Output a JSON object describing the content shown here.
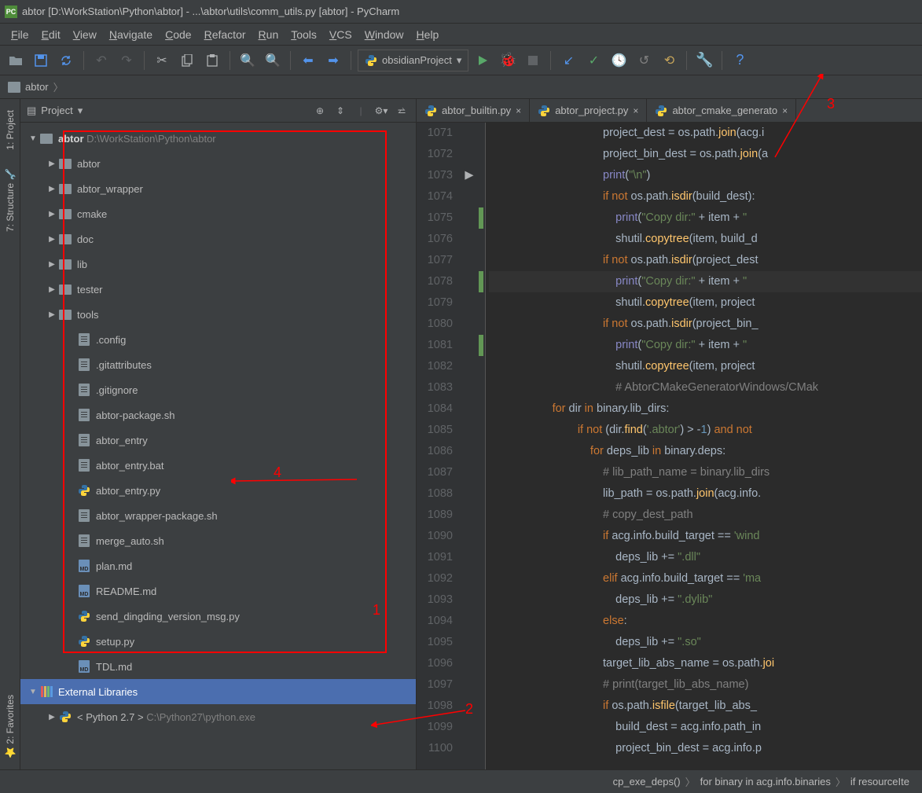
{
  "title": "abtor [D:\\WorkStation\\Python\\abtor] - ...\\abtor\\utils\\comm_utils.py [abtor] - PyCharm",
  "menu": [
    "File",
    "Edit",
    "View",
    "Navigate",
    "Code",
    "Refactor",
    "Run",
    "Tools",
    "VCS",
    "Window",
    "Help"
  ],
  "runconfig": "obsidianProject",
  "breadcrumb_root": "abtor",
  "project_panel": {
    "title": "Project"
  },
  "tree": {
    "root_name": "abtor",
    "root_path": "D:\\WorkStation\\Python\\abtor",
    "folders": [
      "abtor",
      "abtor_wrapper",
      "cmake",
      "doc",
      "lib",
      "tester",
      "tools"
    ],
    "files": [
      {
        "name": ".config",
        "icon": "file"
      },
      {
        "name": ".gitattributes",
        "icon": "file"
      },
      {
        "name": ".gitignore",
        "icon": "file"
      },
      {
        "name": "abtor-package.sh",
        "icon": "file"
      },
      {
        "name": "abtor_entry",
        "icon": "file"
      },
      {
        "name": "abtor_entry.bat",
        "icon": "file"
      },
      {
        "name": "abtor_entry.py",
        "icon": "py"
      },
      {
        "name": "abtor_wrapper-package.sh",
        "icon": "file"
      },
      {
        "name": "merge_auto.sh",
        "icon": "file"
      },
      {
        "name": "plan.md",
        "icon": "md"
      },
      {
        "name": "README.md",
        "icon": "md"
      },
      {
        "name": "send_dingding_version_msg.py",
        "icon": "py"
      },
      {
        "name": "setup.py",
        "icon": "py"
      },
      {
        "name": "TDL.md",
        "icon": "md"
      }
    ],
    "extlib_label": "External Libraries",
    "python_label": "< Python 2.7 >",
    "python_path": "C:\\Python27\\python.exe"
  },
  "tabs": [
    "abtor_builtin.py",
    "abtor_project.py",
    "abtor_cmake_generato"
  ],
  "code_lines": [
    {
      "n": 1071,
      "ind": 20,
      "html": "project_dest = os.path.<span class='fn'>join</span>(acg.i"
    },
    {
      "n": 1072,
      "ind": 20,
      "html": "project_bin_dest = os.path.<span class='fn'>join</span>(a"
    },
    {
      "n": 1073,
      "ind": 20,
      "html": "<span class='builtin'>print</span>(<span class='str'>\"\\n\"</span>)",
      "mk": "play"
    },
    {
      "n": 1074,
      "ind": 20,
      "html": "<span class='kw'>if not </span>os.path.<span class='fn'>isdir</span>(build_dest):"
    },
    {
      "n": 1075,
      "ind": 21,
      "html": "<span class='builtin'>print</span>(<span class='str'>\"Copy dir:\"</span> + item + <span class='str'>\"</span>",
      "mg": true
    },
    {
      "n": 1076,
      "ind": 21,
      "html": "shutil.<span class='fn'>copytree</span>(item, build_d"
    },
    {
      "n": 1077,
      "ind": 20,
      "html": "<span class='kw'>if not </span>os.path.<span class='fn'>isdir</span>(project_dest"
    },
    {
      "n": 1078,
      "ind": 21,
      "html": "<span class='builtin'>print</span>(<span class='str'>\"Copy dir:\"</span> + item + <span class='str'>\"</span>",
      "mg": true,
      "hl": true
    },
    {
      "n": 1079,
      "ind": 21,
      "html": "shutil.<span class='fn'>copytree</span>(item, project"
    },
    {
      "n": 1080,
      "ind": 20,
      "html": "<span class='kw'>if not </span>os.path.<span class='fn'>isdir</span>(project_bin_"
    },
    {
      "n": 1081,
      "ind": 21,
      "html": "<span class='builtin'>print</span>(<span class='str'>\"Copy dir:\"</span> + item + <span class='str'>\"</span>",
      "mg": true
    },
    {
      "n": 1082,
      "ind": 21,
      "html": "shutil.<span class='fn'>copytree</span>(item, project"
    },
    {
      "n": 1083,
      "ind": 21,
      "html": "<span class='cm'># AbtorCMakeGeneratorWindows/CMak</span>"
    },
    {
      "n": 1084,
      "ind": 16,
      "html": "<span class='kw'>for </span>dir<span class='kw'> in </span>binary.lib_dirs:"
    },
    {
      "n": 1085,
      "ind": 18,
      "html": "<span class='kw'>if not </span>(dir.<span class='fn'>find</span>(<span class='str'>'.abtor'</span>) &gt; -<span class='nm'>1</span>)<span class='kw'> and not</span>"
    },
    {
      "n": 1086,
      "ind": 19,
      "html": "<span class='kw'>for </span>deps_lib<span class='kw'> in </span>binary.deps:"
    },
    {
      "n": 1087,
      "ind": 20,
      "html": "<span class='cm'># lib_path_name = binary.lib_dirs</span>"
    },
    {
      "n": 1088,
      "ind": 20,
      "html": "lib_path = os.path.<span class='fn'>join</span>(acg.info."
    },
    {
      "n": 1089,
      "ind": 20,
      "html": "<span class='cm'># copy_dest_path</span>"
    },
    {
      "n": 1090,
      "ind": 20,
      "html": "<span class='kw'>if </span>acg.info.build_target == <span class='str'>'wind</span>"
    },
    {
      "n": 1091,
      "ind": 21,
      "html": "deps_lib += <span class='str'>\".dll\"</span>"
    },
    {
      "n": 1092,
      "ind": 20,
      "html": "<span class='kw'>elif </span>acg.info.build_target == <span class='str'>'ma</span>"
    },
    {
      "n": 1093,
      "ind": 21,
      "html": "deps_lib += <span class='str'>\".dylib\"</span>"
    },
    {
      "n": 1094,
      "ind": 20,
      "html": "<span class='kw'>else</span>:"
    },
    {
      "n": 1095,
      "ind": 21,
      "html": "deps_lib += <span class='str'>\".so\"</span>"
    },
    {
      "n": 1096,
      "ind": 20,
      "html": "target_lib_abs_name = os.path.<span class='fn'>joi</span>"
    },
    {
      "n": 1097,
      "ind": 20,
      "html": "<span class='cm'># print(target_lib_abs_name)</span>"
    },
    {
      "n": 1098,
      "ind": 20,
      "html": "<span class='kw'>if </span>os.path.<span class='fn'>isfile</span>(target_lib_abs_"
    },
    {
      "n": 1099,
      "ind": 21,
      "html": "build_dest = acg.info.path_in"
    },
    {
      "n": 1100,
      "ind": 21,
      "html": "project_bin_dest = acg.info.p"
    }
  ],
  "bottom_crumbs": [
    "cp_exe_deps()",
    "for binary in acg.info.binaries",
    "if resourceIte"
  ],
  "annotations": {
    "1": "1",
    "2": "2",
    "3": "3",
    "4": "4"
  }
}
